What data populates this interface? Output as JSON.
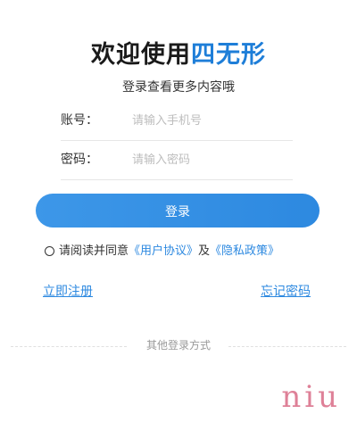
{
  "header": {
    "title_prefix": "欢迎使用",
    "title_brand": "四无形",
    "subtitle": "登录查看更多内容哦"
  },
  "form": {
    "account": {
      "label": "账号：",
      "placeholder": "请输入手机号",
      "value": ""
    },
    "password": {
      "label": "密码：",
      "placeholder": "请输入密码",
      "value": ""
    }
  },
  "login_button_label": "登录",
  "agreement": {
    "checked": false,
    "prefix": "请阅读并同意",
    "user_agreement": "《用户协议》",
    "conjunction": "及",
    "privacy_policy": "《隐私政策》"
  },
  "links": {
    "register": "立即注册",
    "forgot_password": "忘记密码"
  },
  "other_login_label": "其他登录方式",
  "watermark": "niu",
  "colors": {
    "brand": "#1e7ed8",
    "link": "#2d89e0",
    "button": "#3d97e8"
  }
}
